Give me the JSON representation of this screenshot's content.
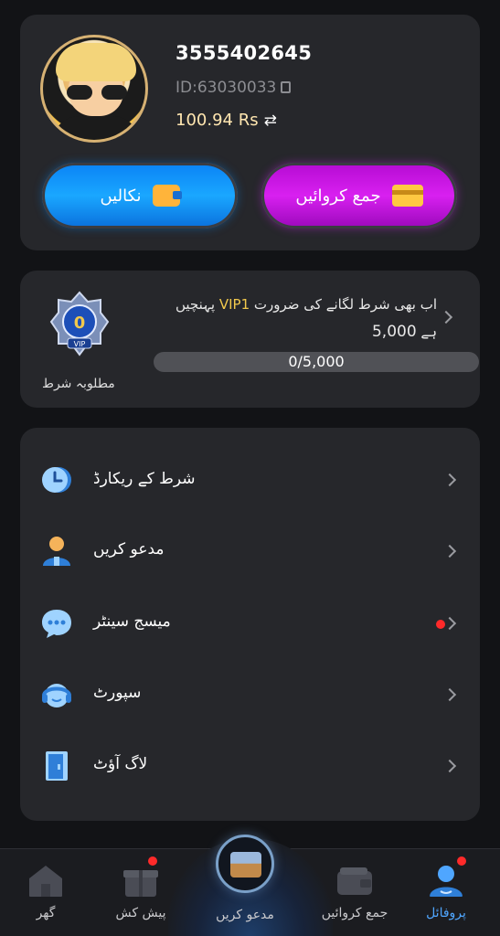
{
  "profile": {
    "username": "3555402645",
    "user_id": "ID:63030033",
    "balance": "100.94 Rs",
    "withdraw_label": "نکالیں",
    "deposit_label": "جمع کروائیں"
  },
  "vip": {
    "badge_number": "0",
    "badge_tag": "VIP",
    "line1_prefix": "اب بھی شرط لگانے کی ضرورت",
    "level": "VIP1",
    "line1_suffix": "پہنچیں",
    "line2_amount": "5,000",
    "line2_suffix": "ہے",
    "progress_text": "0/5,000",
    "progress_fraction": 0,
    "required_label": "مطلوبہ شرط"
  },
  "menu": {
    "items": [
      {
        "label": "شرط کے ریکارڈ"
      },
      {
        "label": "مدعو کریں"
      },
      {
        "label": "میسج سینٹر"
      },
      {
        "label": "سپورٹ"
      },
      {
        "label": "لاگ آؤٹ"
      }
    ]
  },
  "nav": {
    "home": "گھر",
    "offers": "پیش کش",
    "invite": "مدعو کریں",
    "deposit": "جمع کروائیں",
    "profile": "پروفائل"
  },
  "colors": {
    "background": "#121316",
    "card": "#26272b",
    "withdraw_blue": "#1aa7ff",
    "deposit_purple": "#d820f0",
    "vip_gold": "#f2c94c",
    "active_blue": "#4fa6ff",
    "notification_red": "#ff2a2a"
  }
}
